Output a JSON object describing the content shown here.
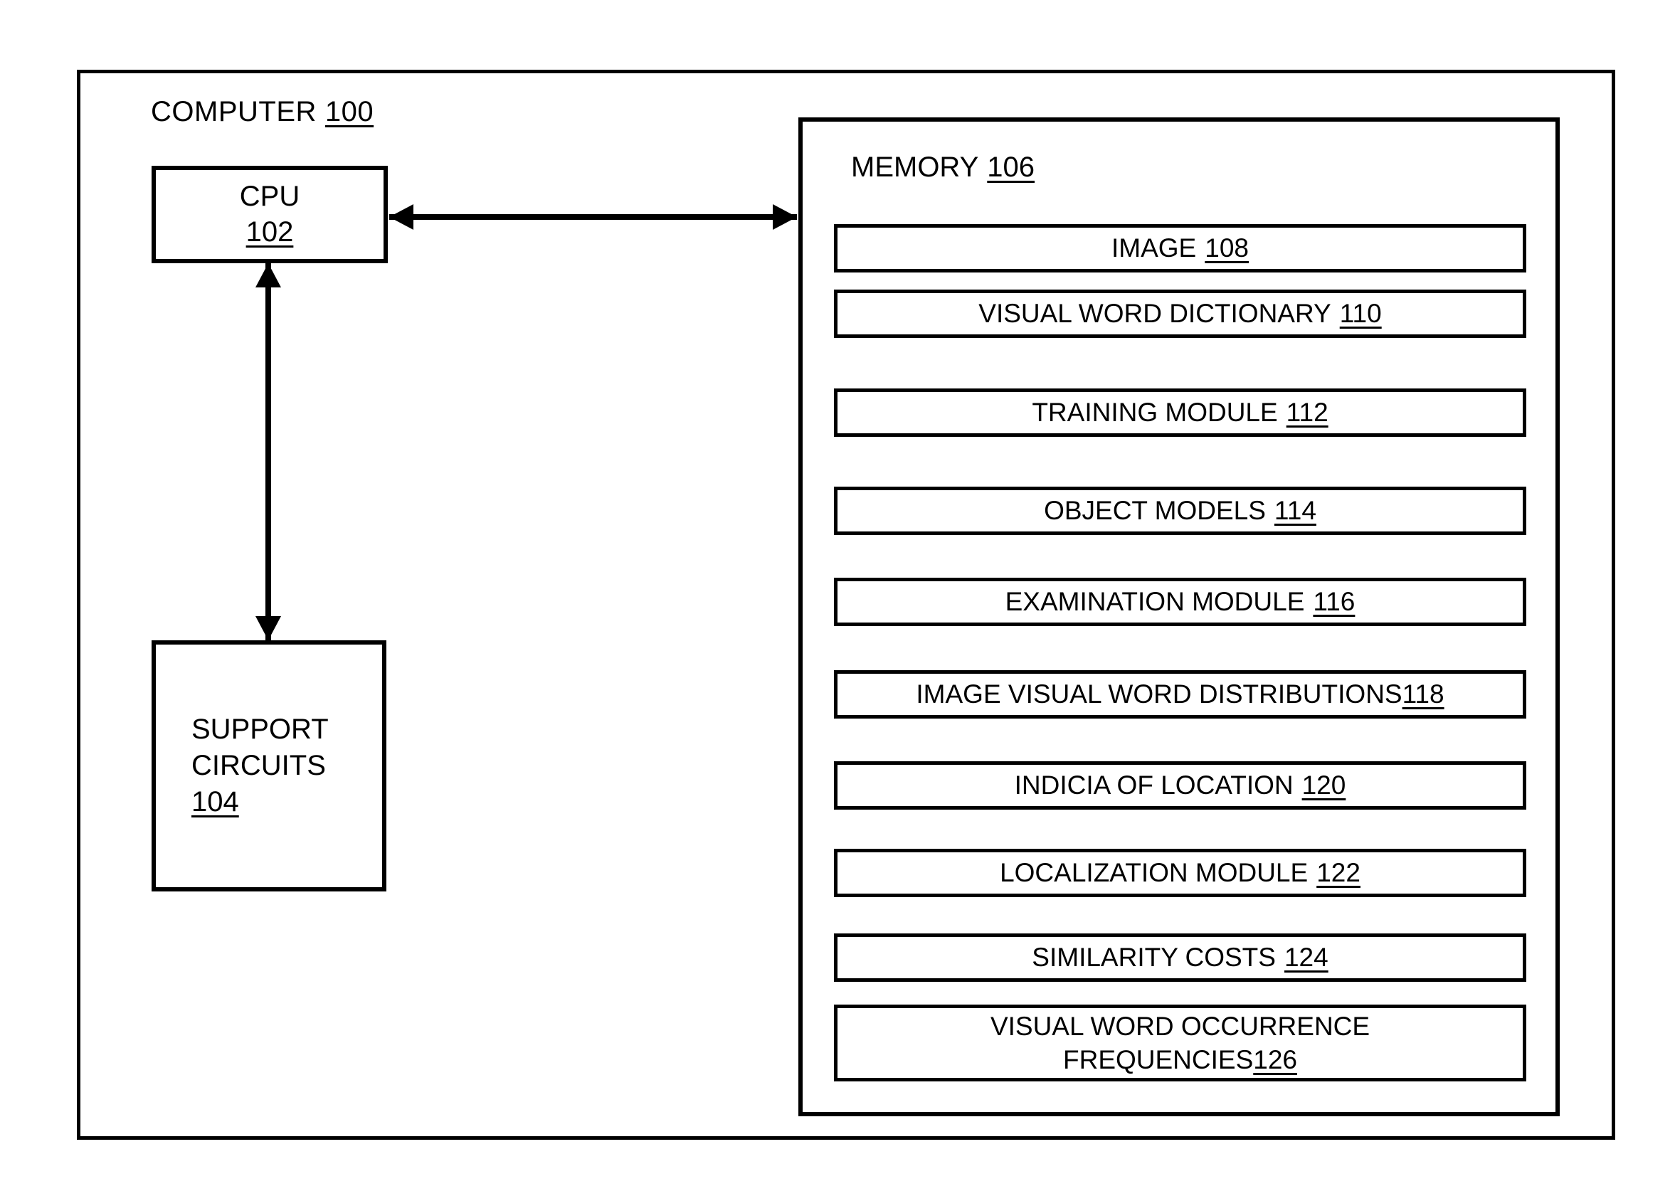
{
  "figure": {
    "type": "patent-block-diagram",
    "computer": {
      "title": "COMPUTER",
      "ref": "100"
    },
    "cpu": {
      "title": "CPU",
      "ref": "102"
    },
    "support_circuits": {
      "line1": "SUPPORT",
      "line2": "CIRCUITS",
      "ref": "104"
    },
    "memory": {
      "title": "MEMORY",
      "ref": "106",
      "items": [
        {
          "label": "IMAGE",
          "ref": "108"
        },
        {
          "label": "VISUAL WORD DICTIONARY",
          "ref": "110"
        },
        {
          "label": "TRAINING MODULE",
          "ref": "112"
        },
        {
          "label": "OBJECT MODELS",
          "ref": "114"
        },
        {
          "label": "EXAMINATION MODULE",
          "ref": "116"
        },
        {
          "label": "IMAGE VISUAL WORD DISTRIBUTIONS",
          "ref": "118"
        },
        {
          "label": "INDICIA OF LOCATION",
          "ref": "120"
        },
        {
          "label": "LOCALIZATION MODULE",
          "ref": "122"
        },
        {
          "label": "SIMILARITY COSTS",
          "ref": "124"
        },
        {
          "label": "VISUAL WORD OCCURRENCE",
          "label2": "FREQUENCIES",
          "ref": "126"
        }
      ]
    },
    "connectors": [
      {
        "name": "cpu-memory-bus",
        "kind": "double-headed-horizontal-arrow"
      },
      {
        "name": "cpu-support-circuits-bus",
        "kind": "double-headed-vertical-arrow"
      }
    ],
    "colors": {
      "ink": "#000000",
      "background": "#ffffff"
    }
  }
}
